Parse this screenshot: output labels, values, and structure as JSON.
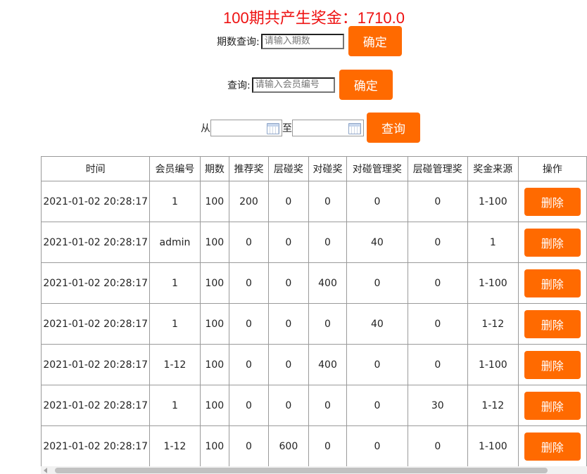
{
  "headline": "100期共产生奖金：1710.0",
  "period_search": {
    "label": "期数查询:",
    "placeholder": "请输入期数",
    "button": "确定"
  },
  "member_search": {
    "label": "查询:",
    "placeholder": "请输入会员编号",
    "button": "确定"
  },
  "date_range": {
    "from_label": "从",
    "to_label": "至",
    "button": "查询"
  },
  "table": {
    "headers": [
      "时间",
      "会员编号",
      "期数",
      "推荐奖",
      "层碰奖",
      "对碰奖",
      "对碰管理奖",
      "层碰管理奖",
      "奖金来源",
      "操作"
    ],
    "rows": [
      {
        "time": "2021-01-02 20:28:17",
        "member": "1",
        "period": "100",
        "recommend": "200",
        "layer": "0",
        "pair": "0",
        "pair_mgmt": "0",
        "layer_mgmt": "0",
        "source": "1-100",
        "action": "删除"
      },
      {
        "time": "2021-01-02 20:28:17",
        "member": "admin",
        "period": "100",
        "recommend": "0",
        "layer": "0",
        "pair": "0",
        "pair_mgmt": "40",
        "layer_mgmt": "0",
        "source": "1",
        "action": "删除"
      },
      {
        "time": "2021-01-02 20:28:17",
        "member": "1",
        "period": "100",
        "recommend": "0",
        "layer": "0",
        "pair": "400",
        "pair_mgmt": "0",
        "layer_mgmt": "0",
        "source": "1-100",
        "action": "删除"
      },
      {
        "time": "2021-01-02 20:28:17",
        "member": "1",
        "period": "100",
        "recommend": "0",
        "layer": "0",
        "pair": "0",
        "pair_mgmt": "40",
        "layer_mgmt": "0",
        "source": "1-12",
        "action": "删除"
      },
      {
        "time": "2021-01-02 20:28:17",
        "member": "1-12",
        "period": "100",
        "recommend": "0",
        "layer": "0",
        "pair": "400",
        "pair_mgmt": "0",
        "layer_mgmt": "0",
        "source": "1-100",
        "action": "删除"
      },
      {
        "time": "2021-01-02 20:28:17",
        "member": "1",
        "period": "100",
        "recommend": "0",
        "layer": "0",
        "pair": "0",
        "pair_mgmt": "0",
        "layer_mgmt": "30",
        "source": "1-12",
        "action": "删除"
      },
      {
        "time": "2021-01-02 20:28:17",
        "member": "1-12",
        "period": "100",
        "recommend": "0",
        "layer": "600",
        "pair": "0",
        "pair_mgmt": "0",
        "layer_mgmt": "0",
        "source": "1-100",
        "action": "删除"
      }
    ]
  },
  "colors": {
    "accent": "#ff6a00",
    "headline": "#ee1111",
    "border": "#9a9a9a"
  }
}
